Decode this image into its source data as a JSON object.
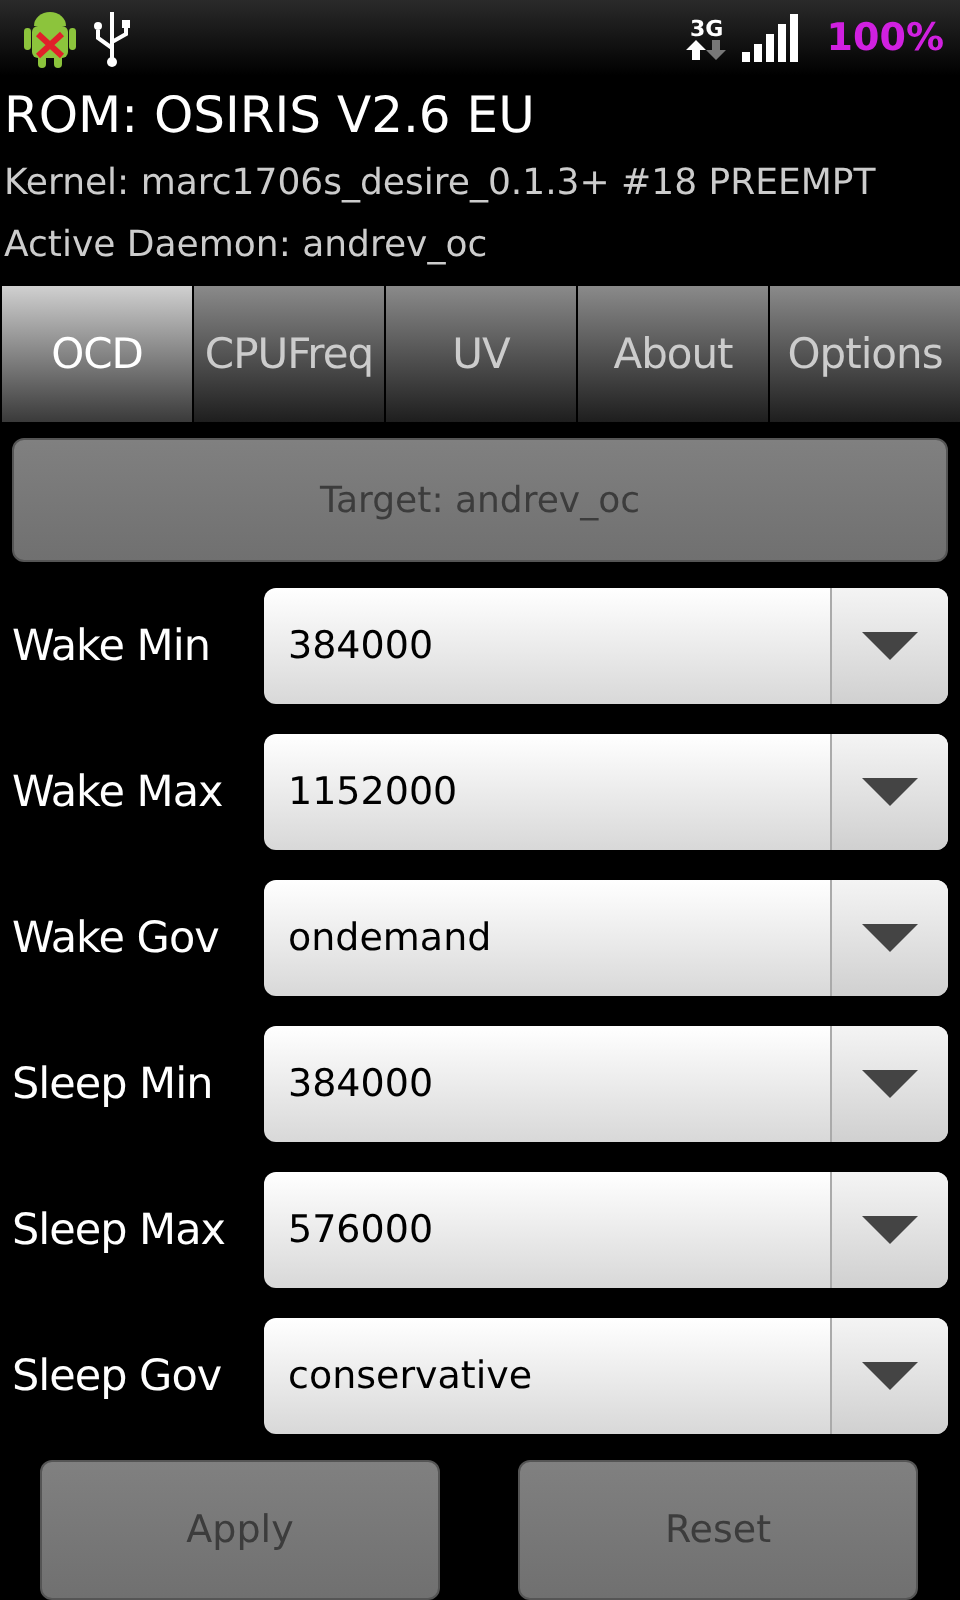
{
  "status_bar": {
    "network": "3G",
    "battery": "100%"
  },
  "header": {
    "rom": "ROM: OSIRIS V2.6 EU",
    "kernel": "Kernel: marc1706s_desire_0.1.3+ #18 PREEMPT",
    "daemon": "Active Daemon: andrev_oc"
  },
  "tabs": [
    {
      "label": "OCD",
      "selected": true
    },
    {
      "label": "CPUFreq",
      "selected": false
    },
    {
      "label": "UV",
      "selected": false
    },
    {
      "label": "About",
      "selected": false
    },
    {
      "label": "Options",
      "selected": false
    }
  ],
  "target_button": {
    "label": "Target: andrev_oc",
    "disabled": true
  },
  "settings": [
    {
      "label": "Wake Min",
      "value": "384000"
    },
    {
      "label": "Wake Max",
      "value": "1152000"
    },
    {
      "label": "Wake Gov",
      "value": "ondemand"
    },
    {
      "label": "Sleep Min",
      "value": "384000"
    },
    {
      "label": "Sleep Max",
      "value": "576000"
    },
    {
      "label": "Sleep Gov",
      "value": "conservative"
    }
  ],
  "buttons": [
    {
      "label": "Apply",
      "disabled": true
    },
    {
      "label": "Reset",
      "disabled": true
    }
  ]
}
